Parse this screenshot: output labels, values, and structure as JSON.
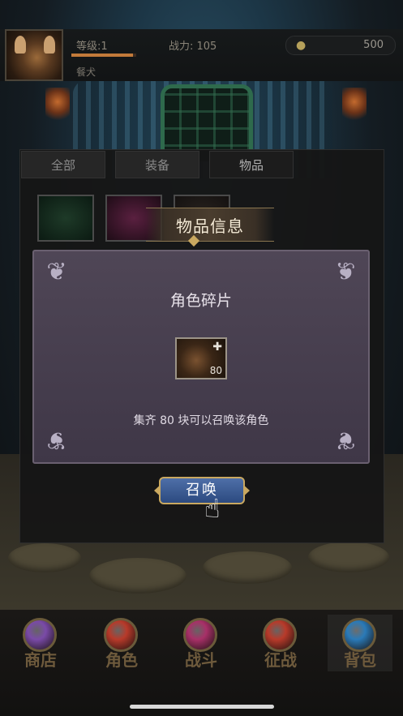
{
  "player": {
    "level_label": "等级:1",
    "power_label": "战力: 105",
    "name": "餐犬",
    "gold": "500",
    "exp_fraction": 0.95
  },
  "bag": {
    "tabs": [
      "全部",
      "装备",
      "物品"
    ],
    "active_tab": 2
  },
  "modal": {
    "title": "物品信息",
    "item_name": "角色碎片",
    "item_count": "80",
    "description": "集齐 80 块可以召唤该角色",
    "summon_label": "召唤"
  },
  "nav": {
    "items": [
      {
        "label": "商店",
        "gem_color": "#7a4aa8"
      },
      {
        "label": "角色",
        "gem_color": "#b83a2a"
      },
      {
        "label": "战斗",
        "gem_color": "#a83068"
      },
      {
        "label": "征战",
        "gem_color": "#b83a2a"
      },
      {
        "label": "背包",
        "gem_color": "#2a7ab8"
      }
    ],
    "active_index": 4
  },
  "colors": {
    "accent_gold": "#c9a860",
    "modal_bg": "#4a4250",
    "button_blue": "#3a5a94"
  }
}
